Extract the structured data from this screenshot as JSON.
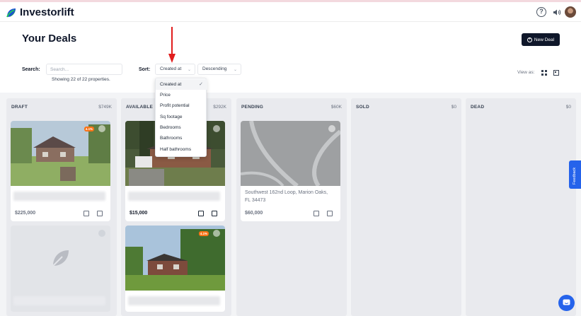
{
  "app": {
    "name": "Investorlift"
  },
  "header": {
    "help_label": "?"
  },
  "page": {
    "title": "Your Deals",
    "new_deal_label": "New Deal"
  },
  "filters": {
    "search_label": "Search:",
    "search_placeholder": "Search...",
    "showing_text": "Showing 22 of 22 properties.",
    "sort_label": "Sort:",
    "sort_value": "Created at",
    "order_value": "Descending",
    "view_as_label": "View as:"
  },
  "sort_menu": {
    "items": [
      {
        "label": "Created at",
        "selected": true
      },
      {
        "label": "Price"
      },
      {
        "label": "Profit potential"
      },
      {
        "label": "Sq footage"
      },
      {
        "label": "Bedrooms"
      },
      {
        "label": "Bathrooms"
      },
      {
        "label": "Half bathrooms"
      }
    ],
    "check_glyph": "✓"
  },
  "columns": [
    {
      "title": "DRAFT",
      "total": "$749K"
    },
    {
      "title": "AVAILABLE",
      "total": "$292K"
    },
    {
      "title": "PENDING",
      "total": "$60K"
    },
    {
      "title": "SOLD",
      "total": "$0"
    },
    {
      "title": "DEAD",
      "total": "$0"
    }
  ],
  "cards": {
    "draft_1": {
      "price": "$225,000",
      "badge": "4.1%"
    },
    "available_1": {
      "price": "$15,000"
    },
    "available_2": {
      "badge": "4.1%"
    },
    "pending_1": {
      "address": "Southwest 162nd Loop, Marion Oaks, FL 34473",
      "price": "$60,000"
    }
  },
  "feedback_label": "Feedback",
  "colors": {
    "primary_dark": "#0f172a",
    "accent_blue": "#2563eb",
    "badge_orange": "#f97316",
    "arrow_red": "#e11d1d"
  }
}
